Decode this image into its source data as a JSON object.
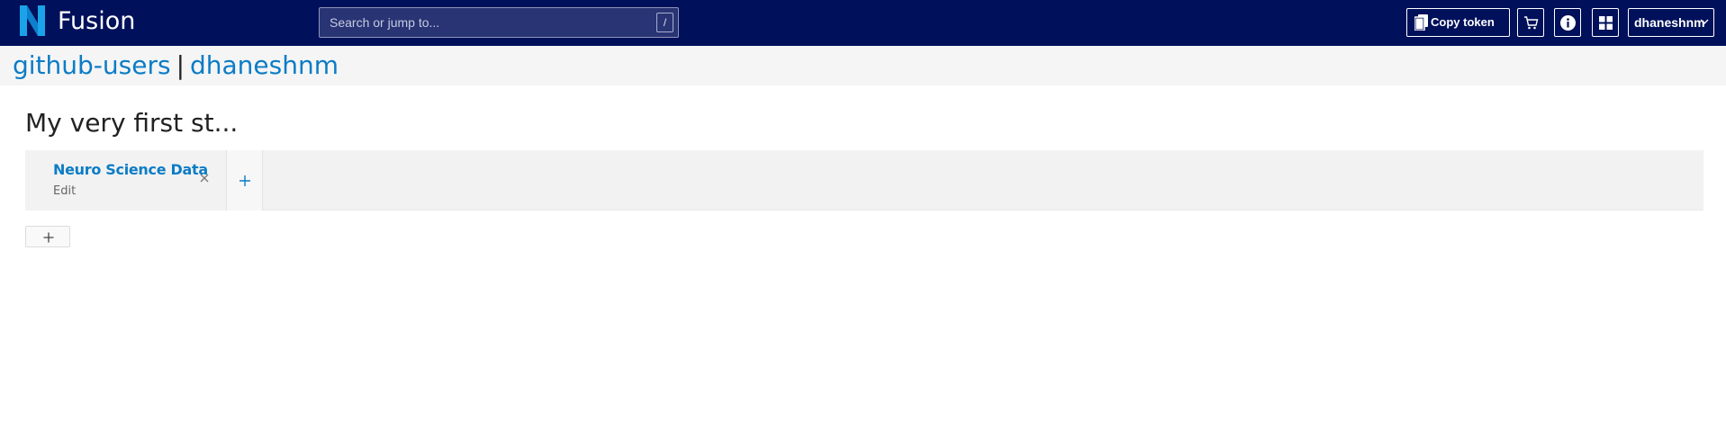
{
  "app": {
    "name": "Fusion",
    "brand_color": "#00105a",
    "accent_color": "#0c7cc6"
  },
  "header": {
    "search_placeholder": "Search or jump to...",
    "search_shortcut": "/",
    "copy_token_label": "Copy token",
    "user_name": "dhaneshnm",
    "icons": [
      "copy-icon",
      "cart-icon",
      "info-icon",
      "apps-grid-icon",
      "chevron-down-icon"
    ]
  },
  "breadcrumb": {
    "organization": "github-users",
    "separator": "|",
    "project": "dhaneshnm"
  },
  "study": {
    "title": "My very first st...",
    "tabs": [
      {
        "title": "Neuro Science Data",
        "edit_label": "Edit"
      }
    ]
  }
}
